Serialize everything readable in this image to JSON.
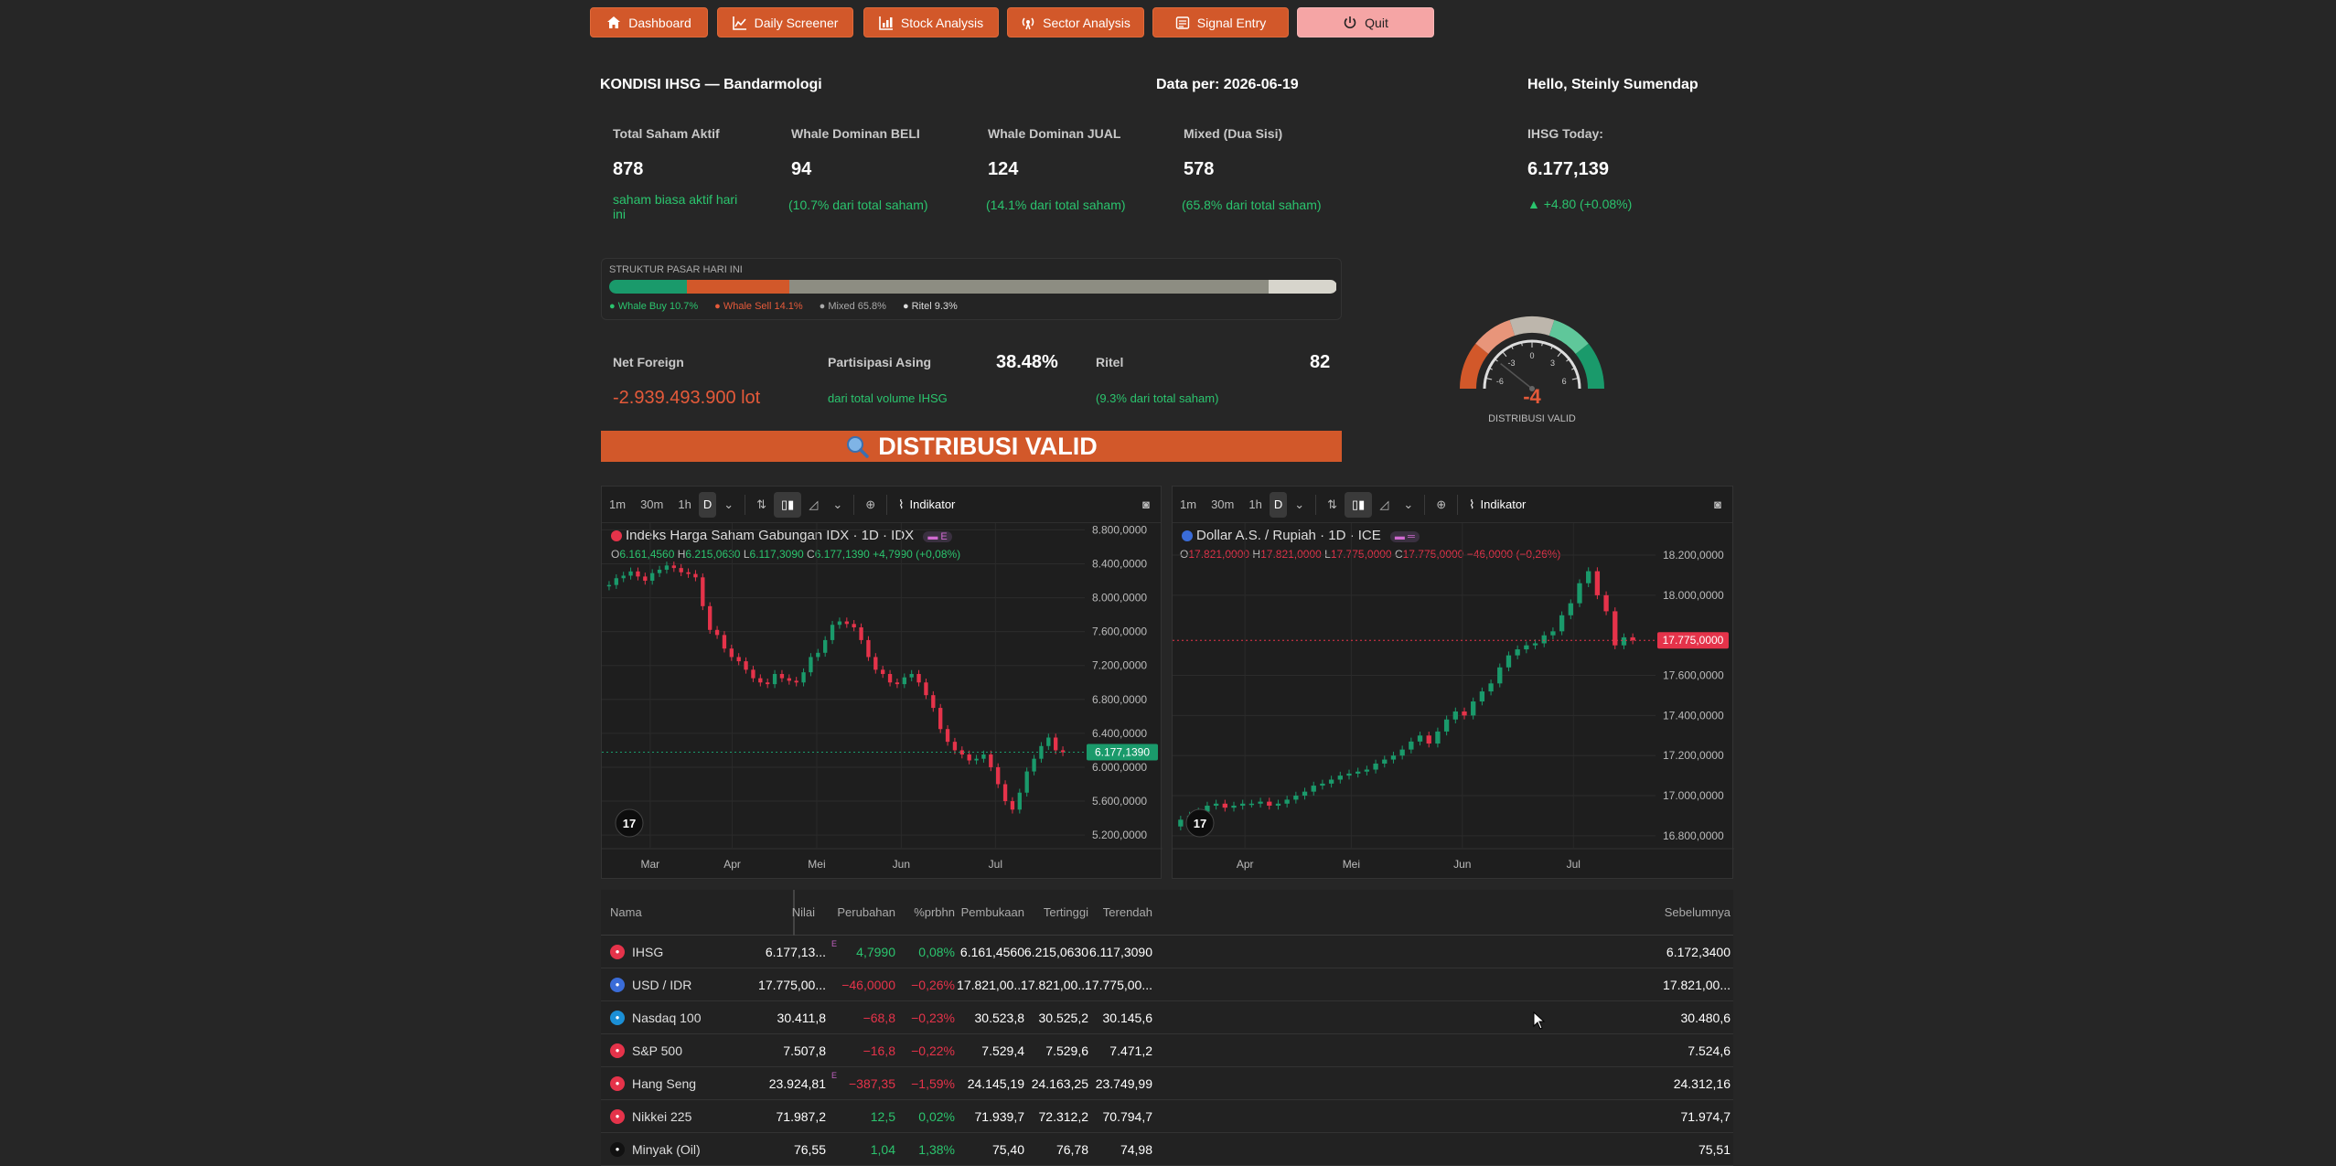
{
  "nav": {
    "dashboard": "Dashboard",
    "daily_screener": "Daily Screener",
    "stock_analysis": "Stock Analysis",
    "sector_analysis": "Sector Analysis",
    "signal_entry": "Signal Entry",
    "quit": "Quit"
  },
  "header": {
    "title": "KONDISI IHSG — Bandarmologi",
    "date": "Data per: 2026-06-19",
    "greeting": "Hello, Steinly Sumendap"
  },
  "stats": {
    "total": {
      "label": "Total Saham Aktif",
      "value": "878",
      "sub": "saham biasa aktif hari ini"
    },
    "buy": {
      "label": "Whale Dominan BELI",
      "value": "94",
      "sub": "(10.7% dari total saham)"
    },
    "sell": {
      "label": "Whale Dominan JUAL",
      "value": "124",
      "sub": "(14.1% dari total saham)"
    },
    "mixed": {
      "label": "Mixed (Dua Sisi)",
      "value": "578",
      "sub": "(65.8% dari total saham)"
    },
    "ihsg": {
      "label": "IHSG Today:",
      "value": "6.177,139",
      "change": "▲ +4.80 (+0.08%)"
    }
  },
  "structure": {
    "title": "STRUKTUR PASAR HARI INI",
    "segments": [
      {
        "label": "● Whale Buy 10.7%",
        "pct": 10.7,
        "color": "#1a9a6b",
        "text_color": "#2bc46e"
      },
      {
        "label": "● Whale Sell 14.1%",
        "pct": 14.1,
        "color": "#d2582a",
        "text_color": "#e55a3a"
      },
      {
        "label": "● Mixed 65.8%",
        "pct": 65.8,
        "color": "#8d8d82",
        "text_color": "#aaa"
      },
      {
        "label": "● Ritel 9.3%",
        "pct": 9.3,
        "color": "#d7d5cc",
        "text_color": "#ddd"
      }
    ]
  },
  "row2": {
    "foreign": {
      "label": "Net Foreign",
      "value": "-2.939.493.900 lot"
    },
    "asing": {
      "label": "Partisipasi Asing",
      "value": "38.48%",
      "sub": "dari total volume IHSG"
    },
    "ritel": {
      "label": "Ritel",
      "value": "82",
      "sub": "(9.3% dari total saham)"
    }
  },
  "gauge": {
    "value": -4,
    "value_text": "-4",
    "label": "DISTRIBUSI VALID",
    "ticks": [
      "-6",
      "-3",
      "0",
      "3",
      "6"
    ],
    "colors": {
      "neg_strong": "#d2582a",
      "neg": "#e8957a",
      "neutral": "#bdb6ac",
      "pos": "#5fc79a",
      "pos_strong": "#1a9a6b"
    }
  },
  "banner": {
    "text": "DISTRIBUSI VALID",
    "icon": "magnifier-icon",
    "color": "#d2582a"
  },
  "toolbar": {
    "tf": [
      "1m",
      "30m",
      "1h",
      "D"
    ],
    "indikator": "Indikator"
  },
  "chart_data": [
    {
      "type": "candlestick",
      "title": "Indeks Harga Saham Gabungan IDX · 1D · IDX",
      "badge": "E",
      "ohlc": {
        "o_label": "O",
        "o": "6.161,4560",
        "h_label": "H",
        "h": "6.215,0630",
        "l_label": "L",
        "l": "6.117,3090",
        "c_label": "C",
        "c": "6.177,1390",
        "chg": "+4,7990 (+0,08%)"
      },
      "y_ticks": [
        "8.800,0000",
        "8.400,0000",
        "8.000,0000",
        "7.600,0000",
        "7.200,0000",
        "6.800,0000",
        "6.400,0000",
        "6.000,0000",
        "5.600,0000",
        "5.200,0000"
      ],
      "y_tick_values": [
        8800,
        8400,
        8000,
        7600,
        7200,
        6800,
        6400,
        6000,
        5600,
        5200
      ],
      "ylim": [
        5050,
        8880
      ],
      "x_ticks": [
        "Mar",
        "Apr",
        "Mei",
        "Jun",
        "Jul"
      ],
      "last_price": "6.177,1390",
      "last_value": 6177.139,
      "last_color": "#1a9a6b",
      "series": [
        {
          "name": "close",
          "values": [
            8150,
            8230,
            8260,
            8310,
            8250,
            8200,
            8290,
            8330,
            8380,
            8350,
            8300,
            8280,
            8240,
            7900,
            7620,
            7560,
            7400,
            7300,
            7250,
            7150,
            7050,
            7000,
            6980,
            7100,
            7050,
            7020,
            7000,
            7120,
            7300,
            7350,
            7500,
            7680,
            7720,
            7690,
            7650,
            7500,
            7300,
            7150,
            7100,
            7000,
            6980,
            7060,
            7100,
            7000,
            6850,
            6700,
            6450,
            6300,
            6200,
            6150,
            6080,
            6100,
            6150,
            6000,
            5800,
            5600,
            5500,
            5700,
            5950,
            6100,
            6250,
            6350,
            6200,
            6177
          ]
        }
      ]
    },
    {
      "type": "candlestick",
      "title": "Dollar A.S. / Rupiah · 1D · ICE",
      "ohlc": {
        "o_label": "O",
        "o": "17.821,0000",
        "h_label": "H",
        "h": "17.821,0000",
        "l_label": "L",
        "l": "17.775,0000",
        "c_label": "C",
        "c": "17.775,0000",
        "chg": "−46,0000 (−0,26%)"
      },
      "y_ticks": [
        "18.200,0000",
        "18.000,0000",
        "17.600,0000",
        "17.400,0000",
        "17.200,0000",
        "17.000,0000",
        "16.800,0000"
      ],
      "y_tick_values": [
        18200,
        18000,
        17600,
        17400,
        17200,
        17000,
        16800
      ],
      "ylim": [
        16740,
        18360
      ],
      "x_ticks": [
        "Apr",
        "Mei",
        "Jun",
        "Jul"
      ],
      "last_price": "17.775,0000",
      "last_value": 17775,
      "last_color": "#e5334a",
      "series": [
        {
          "name": "close",
          "values": [
            16880,
            16900,
            16920,
            16950,
            16960,
            16940,
            16950,
            16960,
            16960,
            16970,
            16950,
            16960,
            16980,
            17000,
            17020,
            17050,
            17060,
            17080,
            17100,
            17110,
            17120,
            17130,
            17160,
            17180,
            17200,
            17230,
            17270,
            17300,
            17260,
            17320,
            17380,
            17420,
            17400,
            17470,
            17520,
            17560,
            17640,
            17700,
            17730,
            17750,
            17760,
            17800,
            17820,
            17900,
            17960,
            18060,
            18120,
            18000,
            17920,
            17750,
            17790,
            17775
          ]
        }
      ]
    }
  ],
  "table": {
    "headers": [
      "Nama",
      "Nilai",
      "Perubahan",
      "%prbhn",
      "Pembukaan",
      "Tertinggi",
      "Terendah",
      "Sebelumnya"
    ],
    "rows": [
      {
        "name": "IHSG",
        "icon": "ihsg-icon",
        "icon_color": "#e5334a",
        "nilai": "6.177,13...",
        "flag": "E",
        "chg": "4,7990",
        "pct": "0,08%",
        "open": "6.161,4560",
        "high": "6.215,0630",
        "low": "6.117,3090",
        "prev": "6.172,3400",
        "dir": "up"
      },
      {
        "name": "USD / IDR",
        "icon": "usd-idr-flag-icon",
        "icon_color": "#3a6cd8",
        "nilai": "17.775,00...",
        "flag": "",
        "chg": "−46,0000",
        "pct": "−0,26%",
        "open": "17.821,00...",
        "high": "17.821,00...",
        "low": "17.775,00...",
        "prev": "17.821,00...",
        "dir": "down"
      },
      {
        "name": "Nasdaq 100",
        "icon": "nasdaq-icon",
        "icon_color": "#1b8fd6",
        "nilai": "30.411,8",
        "flag": "",
        "chg": "−68,8",
        "pct": "−0,23%",
        "open": "30.523,8",
        "high": "30.525,2",
        "low": "30.145,6",
        "prev": "30.480,6",
        "dir": "down"
      },
      {
        "name": "S&P 500",
        "icon": "sp500-icon",
        "icon_color": "#e5334a",
        "nilai": "7.507,8",
        "flag": "",
        "chg": "−16,8",
        "pct": "−0,22%",
        "open": "7.529,4",
        "high": "7.529,6",
        "low": "7.471,2",
        "prev": "7.524,6",
        "dir": "down"
      },
      {
        "name": "Hang Seng",
        "icon": "hang-seng-icon",
        "icon_color": "#e5334a",
        "nilai": "23.924,81",
        "flag": "E",
        "chg": "−387,35",
        "pct": "−1,59%",
        "open": "24.145,19",
        "high": "24.163,25",
        "low": "23.749,99",
        "prev": "24.312,16",
        "dir": "down"
      },
      {
        "name": "Nikkei 225",
        "icon": "nikkei-icon",
        "icon_color": "#e5334a",
        "nilai": "71.987,2",
        "flag": "",
        "chg": "12,5",
        "pct": "0,02%",
        "open": "71.939,7",
        "high": "72.312,2",
        "low": "70.794,7",
        "prev": "71.974,7",
        "dir": "up"
      },
      {
        "name": "Minyak (Oil)",
        "icon": "oil-drop-icon",
        "icon_color": "#111",
        "nilai": "76,55",
        "flag": "",
        "chg": "1,04",
        "pct": "1,38%",
        "open": "75,40",
        "high": "76,78",
        "low": "74,98",
        "prev": "75,51",
        "dir": "up"
      }
    ]
  }
}
